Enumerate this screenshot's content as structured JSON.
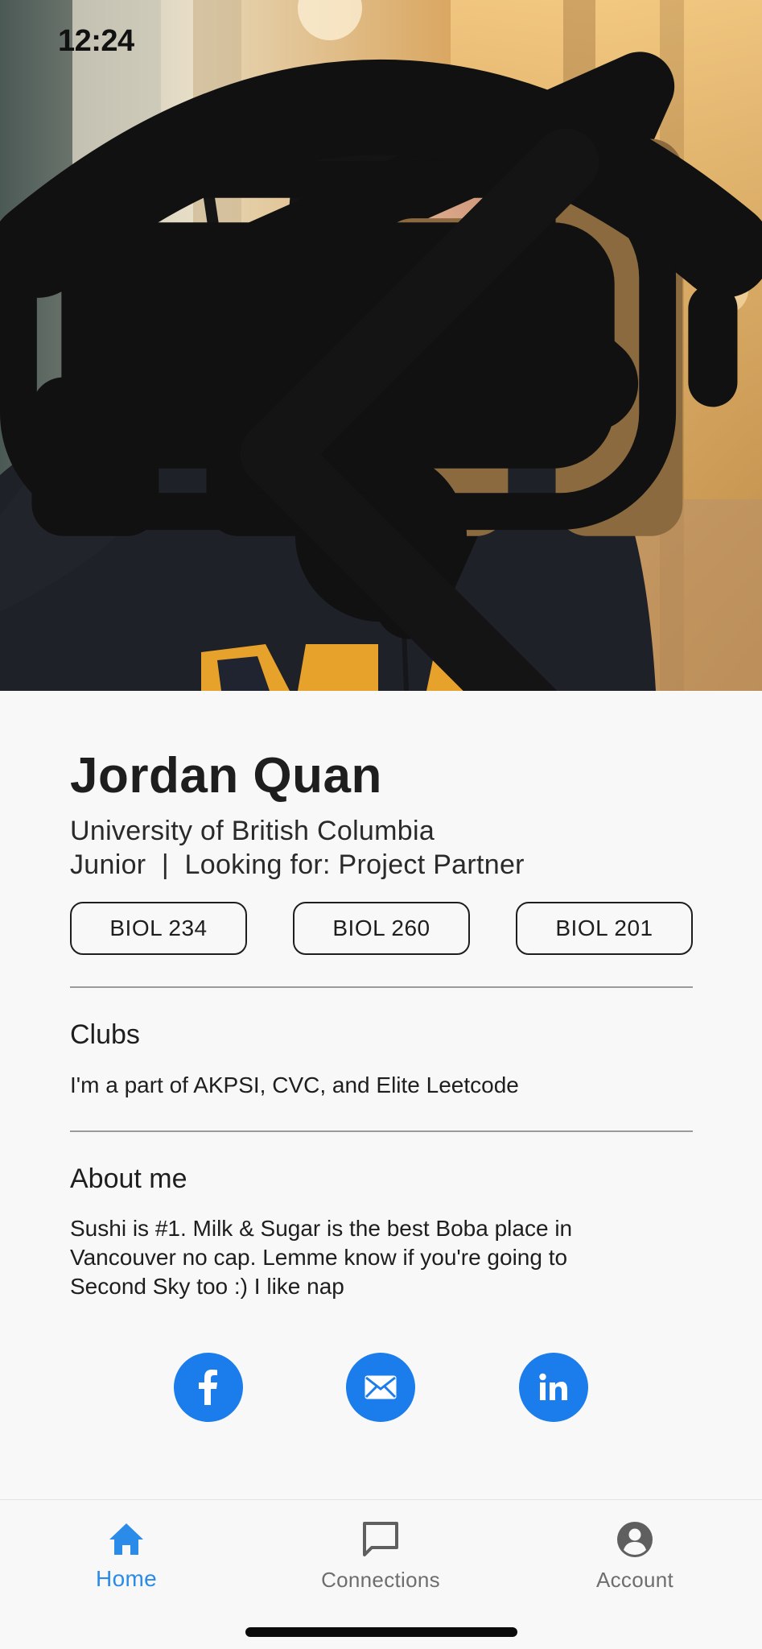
{
  "status_bar": {
    "time": "12:24"
  },
  "profile": {
    "name": "Jordan Quan",
    "university": "University of British Columbia",
    "meta_line": "Junior  |  Looking for: Project Partner",
    "courses": [
      "BIOL 234",
      "BIOL 260",
      "BIOL 201"
    ]
  },
  "clubs": {
    "title": "Clubs",
    "body": "I'm a part of AKPSI, CVC, and Elite Leetcode"
  },
  "about": {
    "title": "About me",
    "body_lines": [
      "Sushi is #1.  Milk & Sugar is the best Boba place in",
      "Vancouver no cap.  Lemme know if you're going to",
      "Second Sky too :) I like nap"
    ]
  },
  "social": {
    "icons": [
      "facebook-icon",
      "mail-icon",
      "linkedin-icon"
    ]
  },
  "tabbar": {
    "home_label": "Home",
    "connections_label": "Connections",
    "account_label": "Account",
    "active_tab": "Home"
  },
  "colors": {
    "accent_blue": "#1b7cec",
    "active_tab": "#2a8ce8",
    "inactive_tab": "#6e6e6e",
    "background": "#f8f8f8"
  }
}
